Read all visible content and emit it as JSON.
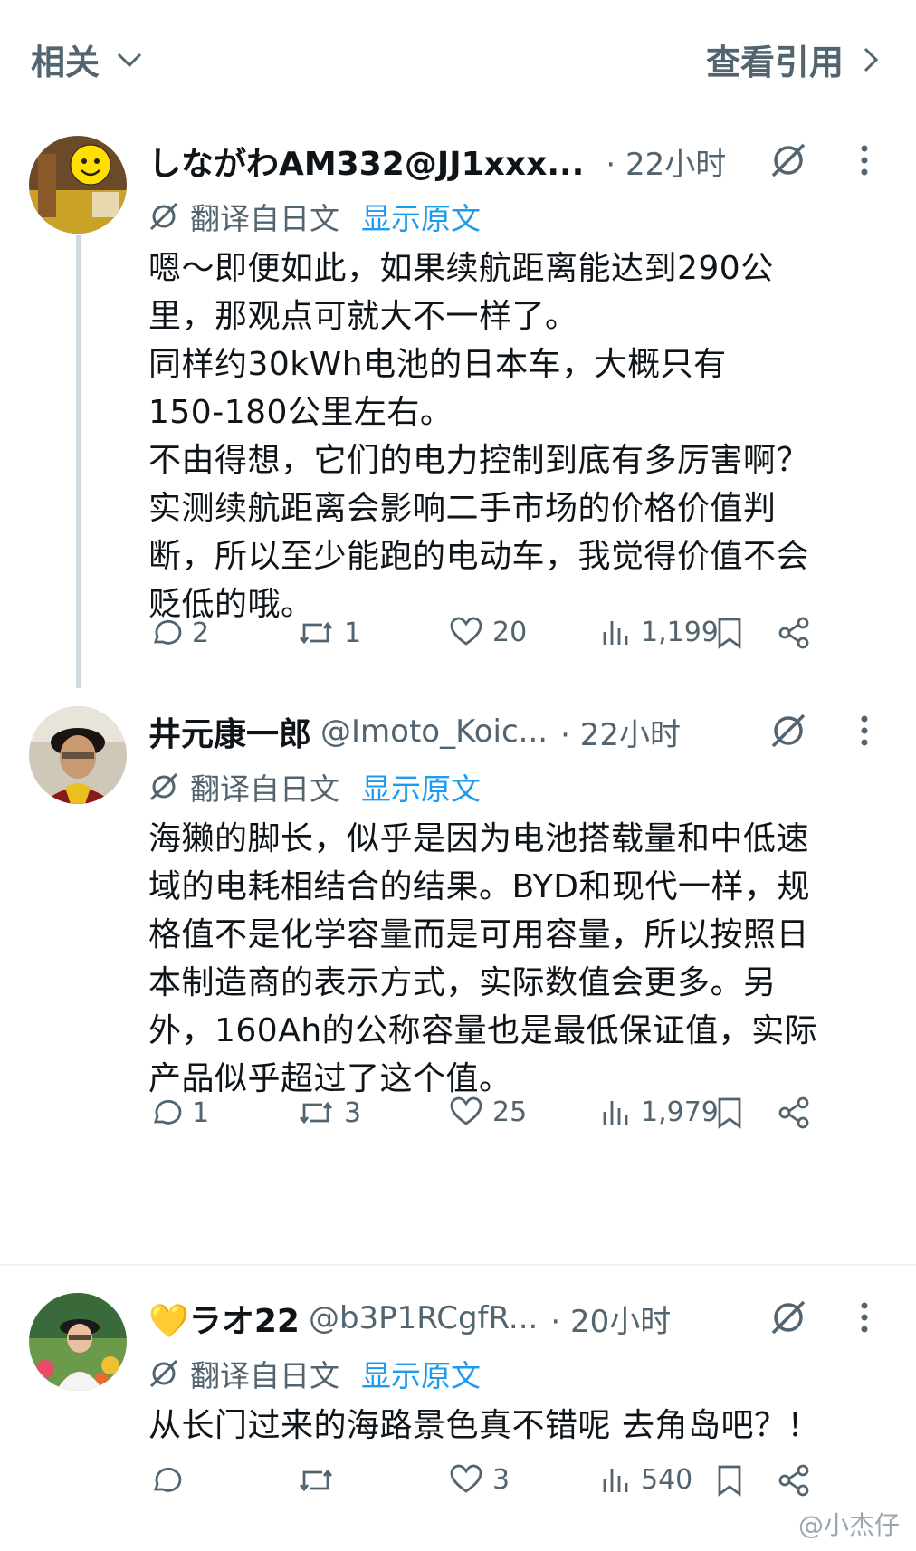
{
  "topbar": {
    "related_label": "相关",
    "view_quotes_label": "查看引用"
  },
  "translate": {
    "label": "翻译自日文",
    "show_original": "显示原文"
  },
  "posts": [
    {
      "name": "しながわAM332@JJ1xxx...",
      "handle": "",
      "time": "· 22小时",
      "text": "嗯～即便如此，如果续航距离能达到290公\n里，那观点可就大不一样了。\n同样约30kWh电池的日本车，大概只有\n150-180公里左右。\n不由得想，它们的电力控制到底有多厉害啊？\n实测续航距离会影响二手市场的价格价值判\n断，所以至少能跑的电动车，我觉得价值不会\n贬低的哦。",
      "replies": "2",
      "reposts": "1",
      "likes": "20",
      "views": "1,199"
    },
    {
      "name": "井元康一郎",
      "handle": "@Imoto_Koic...",
      "time": "· 22小时",
      "text": "海獭的脚长，似乎是因为电池搭载量和中低速\n域的电耗相结合的结果。BYD和现代一样，规\n格值不是化学容量而是可用容量，所以按照日\n本制造商的表示方式，实际数值会更多。另\n外，160Ah的公称容量也是最低保证值，实际\n产品似乎超过了这个值。",
      "replies": "1",
      "reposts": "3",
      "likes": "25",
      "views": "1,979"
    },
    {
      "name": "💛ラオ22",
      "handle": "@b3P1RCgfR...",
      "time": "· 20小时",
      "text": "从长门过来的海路景色真不错呢 去角岛吧？！",
      "replies": "",
      "reposts": "",
      "likes": "3",
      "views": "540"
    }
  ],
  "watermark": "@小杰仔",
  "colors": {
    "link": "#1d9bf0",
    "secondary": "#536471",
    "text": "#0f1419",
    "thread_line": "#cfd9de"
  }
}
